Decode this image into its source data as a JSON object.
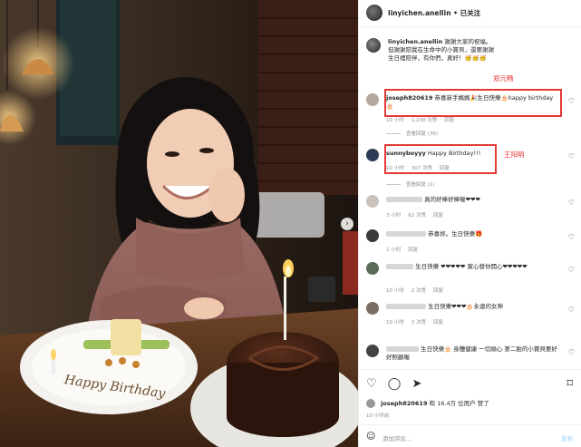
{
  "header": {
    "username": "linyichen.anellin",
    "follow_label": "已关注"
  },
  "caption": {
    "username": "linyichen.anellin",
    "text": "謝謝大家的祝福。但謝謝陪我在生命中的小寶貝，還要謝謝生日裡陪伴，有你們，真好！🥳🥳🥳"
  },
  "annotations": {
    "zheng": "郑元畅",
    "wang": "王阳明"
  },
  "comments": [
    {
      "username": "joseph820619",
      "text": "恭喜新手媽媽🎉生日快樂🎂happy birthday🎂",
      "time": "10 小时",
      "likes": "1,238 次赞",
      "reply": "回复",
      "view_replies": "查看回复 (36)"
    },
    {
      "username": "sunnyboyyy",
      "text": "Happy Birthday!!!",
      "time": "10 小时",
      "likes": "307 次赞",
      "reply": "回复",
      "view_replies": "查看回复 (1)"
    },
    {
      "username": "",
      "text": "真的好棒好棒喔❤❤❤",
      "time": "3 小时",
      "likes": "62 次赞",
      "reply": "回复"
    },
    {
      "username": "",
      "text": "恭喜妳。生日快樂🎁",
      "time": "1 小时",
      "likes": "",
      "reply": "回复"
    },
    {
      "username": "",
      "text": "生日快樂 ❤❤❤❤❤ 寅心替你開心❤❤❤❤❤",
      "time": "10 小时",
      "likes": "2 次赞",
      "reply": "回复"
    },
    {
      "username": "",
      "text": "生日快樂❤❤❤🎂永遠的女神",
      "time": "10 小时",
      "likes": "3 次赞",
      "reply": "回复"
    },
    {
      "username": "",
      "text": "生日快樂🎂 身體健康 一切順心 第二胎的小寶貝要好好照顧喔",
      "time": "",
      "likes": "",
      "reply": ""
    }
  ],
  "footer": {
    "liked_by_user": "joseph820619",
    "likes_text": "和 16.4万 位用户 赞了",
    "time_ago": "10 小时前",
    "add_comment_placeholder": "添加评论...",
    "post_label": "发布"
  },
  "icons": [
    "heart-icon",
    "comment-icon",
    "share-icon",
    "bookmark-icon",
    "emoji-icon"
  ]
}
